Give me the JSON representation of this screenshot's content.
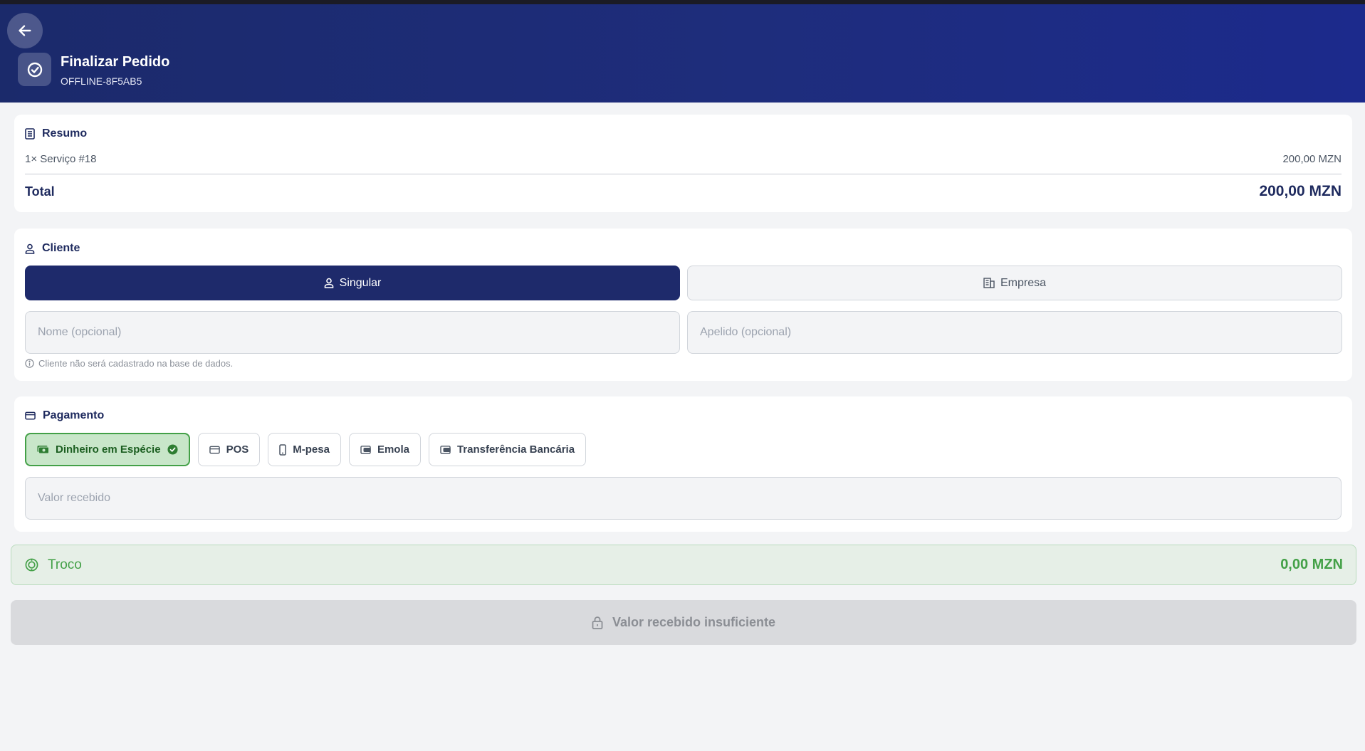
{
  "header": {
    "title": "Finalizar Pedido",
    "order_id": "OFFLINE-8F5AB5"
  },
  "resumo": {
    "title": "Resumo",
    "items": [
      {
        "label": "1× Serviço #18",
        "price": "200,00 MZN"
      }
    ],
    "total_label": "Total",
    "total_value": "200,00 MZN"
  },
  "cliente": {
    "title": "Cliente",
    "type_options": [
      "Singular",
      "Empresa"
    ],
    "selected_type": "Singular",
    "nome_placeholder": "Nome (opcional)",
    "apelido_placeholder": "Apelido (opcional)",
    "hint": "Cliente não será cadastrado na base de dados."
  },
  "pagamento": {
    "title": "Pagamento",
    "methods": [
      {
        "label": "Dinheiro em Espécie",
        "icon": "cash-icon",
        "selected": true
      },
      {
        "label": "POS",
        "icon": "card-icon",
        "selected": false
      },
      {
        "label": "M-pesa",
        "icon": "phone-icon",
        "selected": false
      },
      {
        "label": "Emola",
        "icon": "wallet-icon",
        "selected": false
      },
      {
        "label": "Transferência Bancária",
        "icon": "wallet-icon",
        "selected": false
      }
    ],
    "valor_placeholder": "Valor recebido"
  },
  "troco": {
    "label": "Troco",
    "value": "0,00 MZN"
  },
  "submit": {
    "label": "Valor recebido insuficiente",
    "enabled": false
  },
  "colors": {
    "primary": "#1e2a6b",
    "success": "#43a047",
    "selected_bg": "#c8e6c9"
  }
}
